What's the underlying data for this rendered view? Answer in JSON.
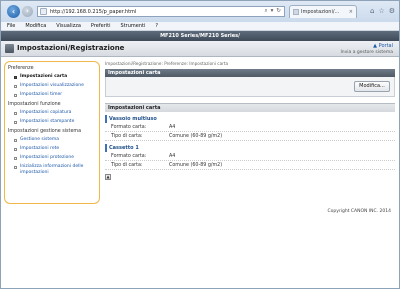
{
  "browser": {
    "url": "http://192.168.0.215/p_paper.html",
    "url_actions": [
      "⌕",
      "▾",
      "↻"
    ],
    "tab_title": "Impostazioni/...",
    "tab_close": "×",
    "window_icons": [
      "⌂",
      "☆",
      "⚙"
    ],
    "menu": [
      "File",
      "Modifica",
      "Visualizza",
      "Preferiti",
      "Strumenti",
      "?"
    ]
  },
  "header": {
    "device": "MF210 Series/MF210 Series/",
    "title": "Impostazioni/Registrazione",
    "portal_label": "Portal",
    "portal_arrow": "▲",
    "admin_link": "Invia a gestore sistema"
  },
  "sidebar": {
    "groups": [
      {
        "heading": "Preferenze",
        "items": [
          {
            "label": "Impostazioni carta",
            "active": true
          },
          {
            "label": "Impostazioni visualizzazione",
            "active": false
          },
          {
            "label": "Impostazioni timer",
            "active": false
          }
        ]
      },
      {
        "heading": "Impostazioni funzione",
        "items": [
          {
            "label": "Impostazioni copiatura",
            "active": false
          },
          {
            "label": "Impostazioni stampante",
            "active": false
          }
        ]
      },
      {
        "heading": "Impostazioni gestione sistema",
        "items": [
          {
            "label": "Gestione sistema",
            "active": false
          },
          {
            "label": "Impostazioni rete",
            "active": false
          },
          {
            "label": "Impostazioni protezione",
            "active": false
          },
          {
            "label": "Inizializza informazioni delle impostazioni",
            "active": false
          }
        ]
      }
    ]
  },
  "main": {
    "breadcrumb": "Impostazioni/Registrazione: Preferenze: Impostazioni carta",
    "panel_title": "Impostazioni carta",
    "modify_button": "Modifica...",
    "section_title": "Impostazioni carta",
    "trays": [
      {
        "name": "Vassoio multiuso",
        "rows": [
          {
            "label": "Formato carta:",
            "value": "A4"
          },
          {
            "label": "Tipo di carta:",
            "value": "Comune (60-89 g/m2)"
          }
        ]
      },
      {
        "name": "Cassetto 1",
        "rows": [
          {
            "label": "Formato carta:",
            "value": "A4"
          },
          {
            "label": "Tipo di carta:",
            "value": "Comune (60-89 g/m2)"
          }
        ]
      }
    ],
    "page_nav": "▲"
  },
  "footer": {
    "copyright": "Copyright CANON INC. 2014"
  }
}
